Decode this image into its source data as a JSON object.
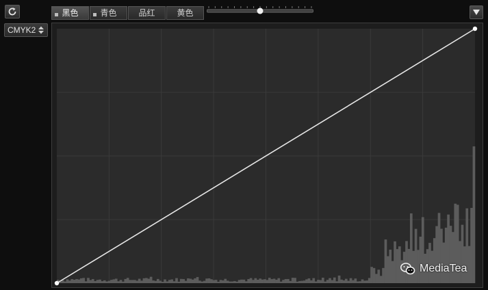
{
  "toolbar": {
    "channel_tabs": [
      {
        "label": "黑色",
        "active": true
      },
      {
        "label": "青色",
        "active": false
      },
      {
        "label": "品红",
        "active": false
      },
      {
        "label": "黄色",
        "active": false
      }
    ],
    "slider_value_fraction": 0.5
  },
  "mode_select": {
    "value": "CMYK2"
  },
  "curve": {
    "input_range": [
      0,
      255
    ],
    "output_range": [
      0,
      255
    ],
    "control_points": [
      [
        0,
        0
      ],
      [
        255,
        255
      ]
    ],
    "grid_divisions": {
      "x": 8,
      "y": 4
    }
  },
  "watermark": {
    "text": "MediaTea",
    "icon": "wechat-icon"
  },
  "colors": {
    "background": "#0e0e0e",
    "plot_area": "#2b2b2b",
    "grid": "#3a3a3a",
    "curve_line": "#e6e6e6",
    "histogram": "#5c5c5c"
  }
}
